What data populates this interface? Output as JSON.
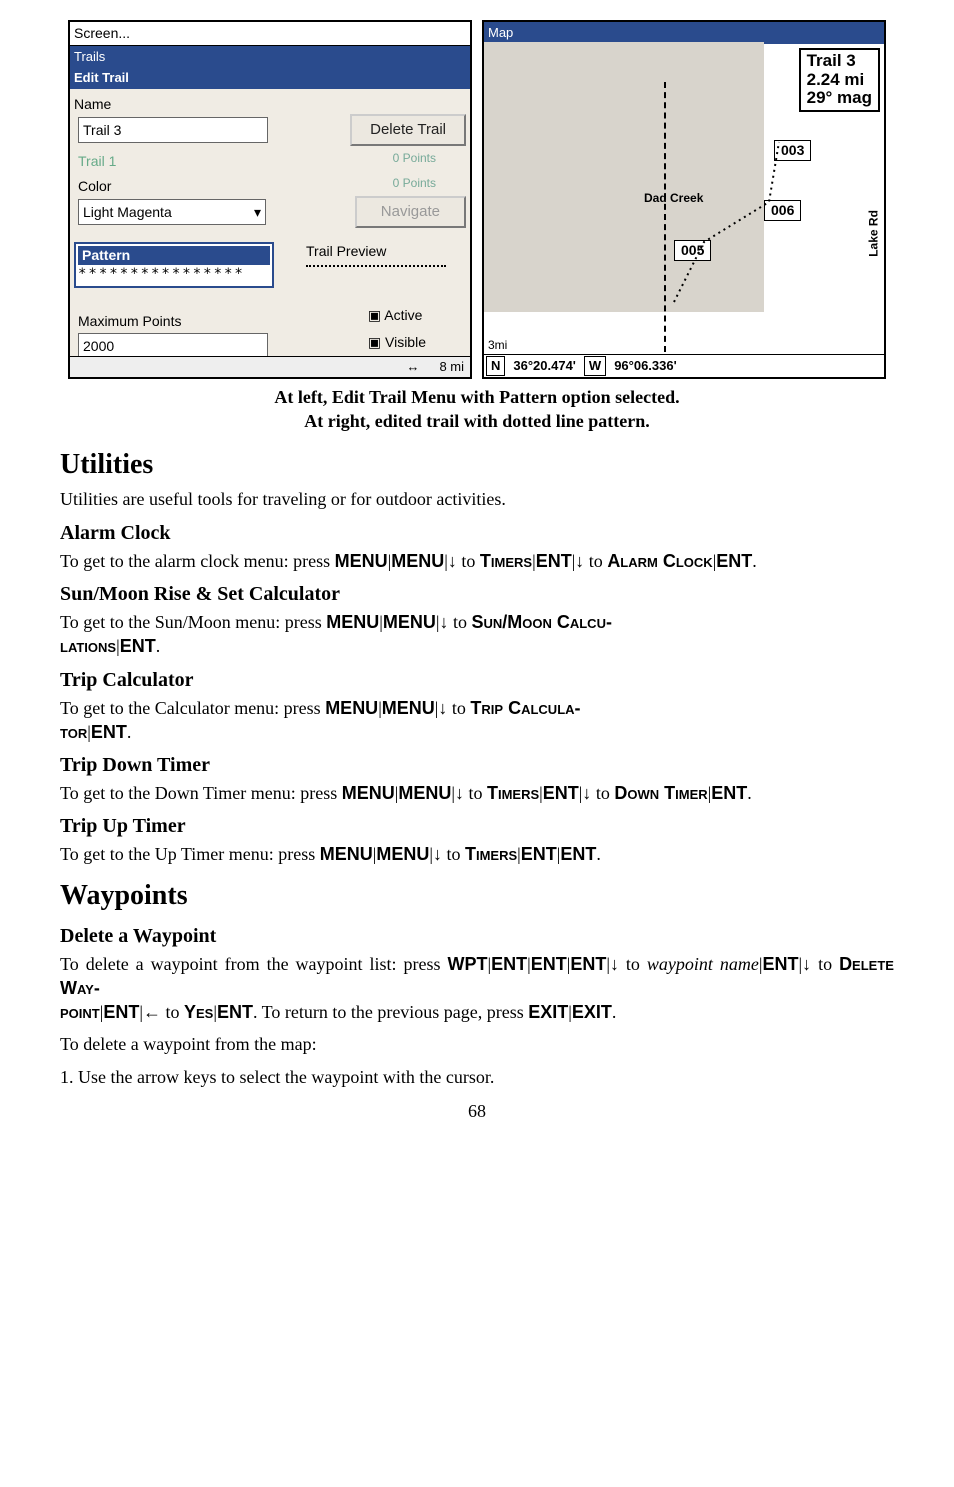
{
  "figure": {
    "left": {
      "window_title": "Screen...",
      "trails_bar": "Trails",
      "edit_trail_bar": "Edit Trail",
      "name_label": "Name",
      "name_value": "Trail 3",
      "delete_btn": "Delete Trail",
      "trail1_ghost": "Trail 1",
      "points0a": "0 Points",
      "points0b": "0 Points",
      "color_label": "Color",
      "color_value": "Light Magenta",
      "navigate_btn": "Navigate",
      "pattern_label": "Pattern",
      "pattern_value": "****************",
      "trail_preview": "Trail Preview",
      "max_points_label": "Maximum Points",
      "max_points_value": "2000",
      "active_cb": "Active",
      "visible_cb": "Visible",
      "arrows": "↔",
      "scale": "8 mi"
    },
    "map": {
      "title": "Map",
      "infobox_l1": "Trail 3",
      "infobox_l2": "2.24 mi",
      "infobox_l3": "29° mag",
      "dad_creek": "Dad Creek",
      "lake_rd": "Lake Rd",
      "chip1": "005",
      "chip2": "006",
      "chip3": "003",
      "scale": "3mi",
      "lat": "36°20.474'",
      "n": "N",
      "w": "W",
      "lon": "96°06.336'"
    },
    "caption_l1": "At left, Edit Trail Menu with Pattern option selected.",
    "caption_l2": "At right, edited trail with dotted line pattern."
  },
  "sections": {
    "utilities_h": "Utilities",
    "utilities_p": "Utilities are useful tools for traveling or for outdoor activities.",
    "alarm_h": "Alarm Clock",
    "alarm_p1": "To get to the alarm clock menu: press ",
    "alarm_menu1": "MENU",
    "alarm_menu2": "MENU",
    "alarm_to1": " to ",
    "alarm_timers": "Timers",
    "alarm_ent1": "ENT",
    "alarm_p2": "to ",
    "alarm_clock": "Alarm Clock",
    "alarm_ent2": "ENT",
    "alarm_period": ".",
    "sun_h": "Sun/Moon Rise & Set Calculator",
    "sun_p1": "To get to the Sun/Moon menu: press ",
    "sun_menu1": "MENU",
    "sun_menu2": "MENU",
    "sun_to": " to ",
    "sun_calc1": "Sun/Moon Calcu-",
    "sun_calc2": "lations",
    "sun_ent": "ENT",
    "trip_h": "Trip Calculator",
    "trip_p1": "To get to the Calculator menu: press ",
    "trip_menu1": "MENU",
    "trip_menu2": "MENU",
    "trip_to": " to ",
    "trip_calc1": "Trip Calcula-",
    "trip_calc2": "tor",
    "trip_ent": "ENT",
    "down_h": "Trip Down Timer",
    "down_p1": "To get to the Down Timer menu: press ",
    "down_menu1": "MENU",
    "down_menu2": "MENU",
    "down_to1": " to ",
    "down_timers": "Timers",
    "down_ent1": "ENT",
    "down_p2": "to ",
    "down_timer": "Down Timer",
    "down_ent2": "ENT",
    "up_h": "Trip Up Timer",
    "up_p1": "To get to the Up Timer menu: press ",
    "up_menu1": "MENU",
    "up_menu2": "MENU",
    "up_to": " to ",
    "up_timers": "Timers",
    "up_ent1": "ENT",
    "up_ent2": "ENT",
    "wpt_h": "Waypoints",
    "del_h": "Delete a Waypoint",
    "del_p1a": "To delete a waypoint from the waypoint list: press",
    "del_wpt": "WPT",
    "del_ent1": "ENT",
    "del_ent2": "ENT",
    "del_ent3": "ENT",
    "del_to1": " to ",
    "del_wpname": "waypoint name",
    "del_ent4": "ENT",
    "del_to2": " to ",
    "del_delete1": "Delete Way-",
    "del_delete2": "point",
    "del_ent5": "ENT",
    "del_to3": " to ",
    "del_yes": "Yes",
    "del_ent6": "ENT",
    "del_p1b": ". To return to the previous page, press",
    "del_exit1": "EXIT",
    "del_exit2": "EXIT",
    "del_p2": "To delete a waypoint from the map:",
    "del_p3": "1. Use the arrow keys to select the waypoint with the cursor.",
    "pipe": "|",
    "darr": "↓",
    "larr": "←"
  },
  "pagenum": "68"
}
